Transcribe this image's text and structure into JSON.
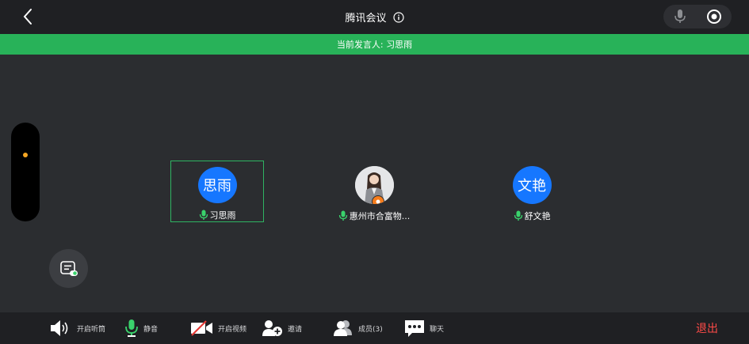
{
  "header": {
    "title": "腾讯会议"
  },
  "banner": {
    "prefix": "当前发言人: ",
    "speaker": "习思雨"
  },
  "participants": [
    {
      "avatar_text": "思雨",
      "name": "习思雨",
      "active": true
    },
    {
      "avatar_text": "",
      "name": "惠州市合富物...",
      "active": false,
      "host": true
    },
    {
      "avatar_text": "文艳",
      "name": "舒文艳",
      "active": false
    }
  ],
  "toolbar": {
    "speaker_label": "开启听筒",
    "mute_label": "静音",
    "video_label": "开启视频",
    "invite_label": "邀请",
    "members_label": "成员(3)",
    "chat_label": "聊天",
    "exit_label": "退出"
  },
  "colors": {
    "accent_green": "#28b259",
    "avatar_blue": "#1677ff",
    "exit_red": "#ff4b48",
    "host_orange": "#f77d1b"
  }
}
